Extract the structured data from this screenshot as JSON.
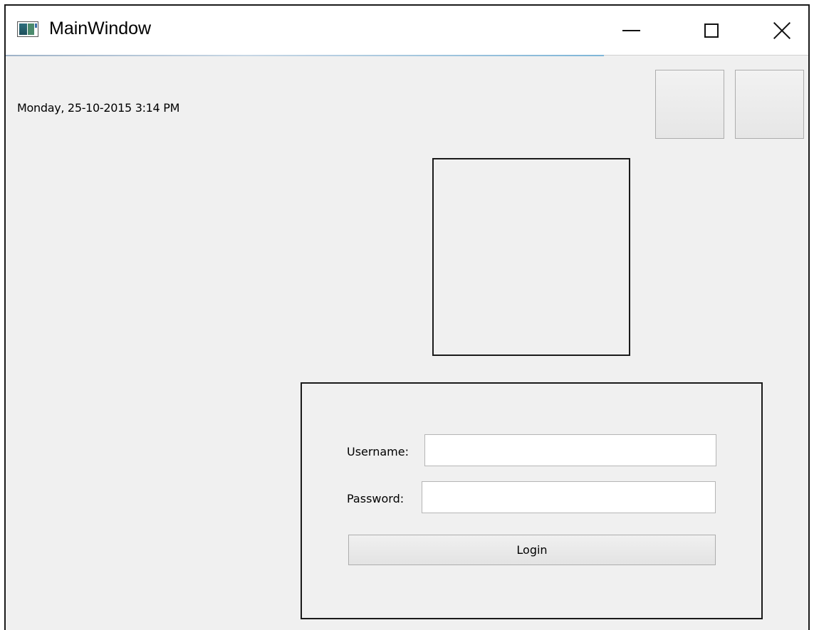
{
  "window": {
    "title": "MainWindow",
    "icon": "app-window-icon",
    "controls": {
      "minimize_icon": "minimize-icon",
      "maximize_icon": "maximize-icon",
      "close_icon": "close-icon"
    }
  },
  "header": {
    "datetime": "Monday, 25-10-2015 3:14 PM"
  },
  "login": {
    "username_label": "Username:",
    "username_value": "",
    "password_label": "Password:",
    "password_value": "",
    "login_button": "Login"
  }
}
